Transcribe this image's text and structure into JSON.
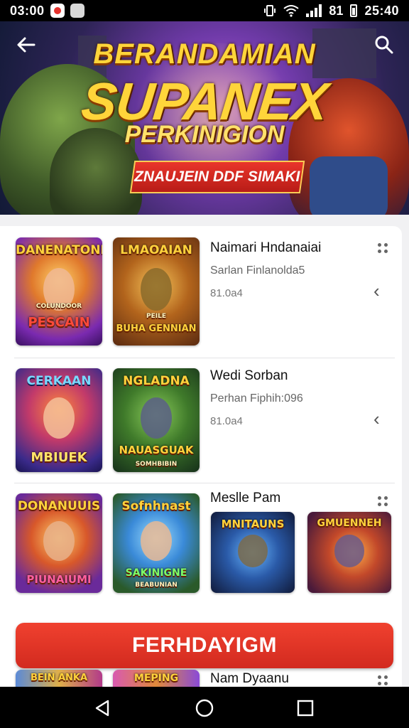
{
  "status_bar": {
    "time": "03:00",
    "battery_text": "81",
    "clock_right": "25:40"
  },
  "hero": {
    "line1": "BERANDAMIAN",
    "line2": "SUPANEX",
    "line3": "PERKINIGION",
    "ribbon": "ZNAUJEIN DDF SIMAKI"
  },
  "games": [
    {
      "name": "Naimari Hndanaiai",
      "subtitle": "Sarlan Finlanolda5",
      "meta": "81.0a4",
      "thumbs": [
        {
          "top": "DANENATONR",
          "bottom": "PESCAIN",
          "sub": "COLUNDOOR"
        },
        {
          "top": "LMAOAIAN",
          "bottom": "BUHA GENNIAN",
          "sub": "PEILE"
        }
      ]
    },
    {
      "name": "Wedi Sorban",
      "subtitle": "Perhan Fiphih:096",
      "meta": "81.0a4",
      "thumbs": [
        {
          "top": "CERKAAN",
          "bottom": "MBIUEK",
          "sub": ""
        },
        {
          "top": "NGLADNA",
          "bottom": "NAUASGUAK",
          "sub": "SOMHBIBIN"
        }
      ]
    },
    {
      "name": "Meslle Pam",
      "thumbs": [
        {
          "top": "DONANUUIS",
          "bottom": "PIUNAIUMI",
          "sub": ""
        },
        {
          "top": "Sofnhnast",
          "bottom": "SAKINIGNE",
          "sub": "BEABUNIAN"
        },
        {
          "top": "MNITAUNS",
          "bottom": "",
          "sub": ""
        },
        {
          "top": "GMUENNEH",
          "bottom": "",
          "sub": ""
        }
      ]
    },
    {
      "name": "Nam Dyaanu",
      "thumbs": [
        {
          "top": "BEIN ANKA",
          "bottom": "",
          "sub": ""
        },
        {
          "top": "MEPING",
          "bottom": "",
          "sub": ""
        }
      ]
    }
  ],
  "cta_label": "FERHDAYIGM"
}
